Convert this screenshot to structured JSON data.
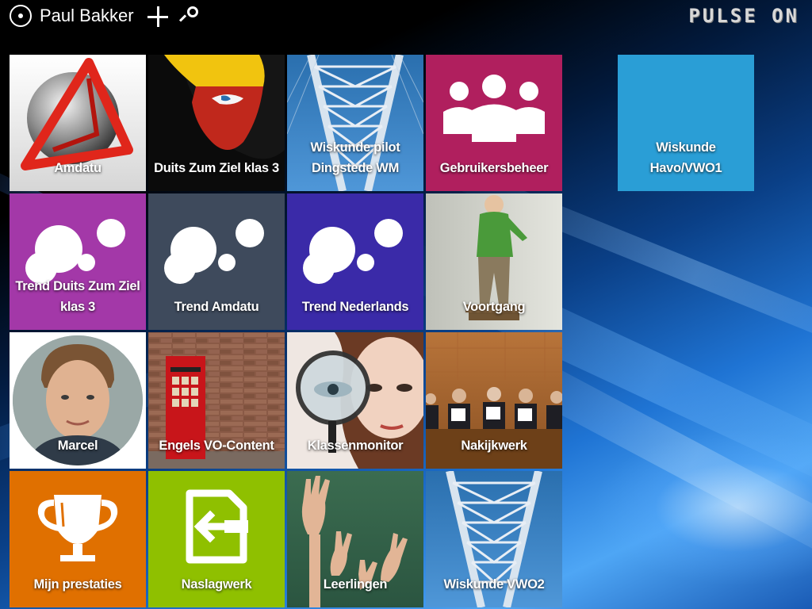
{
  "header": {
    "user_name": "Paul Bakker",
    "logo_text": "PULSE ON",
    "icons": [
      "user-icon",
      "add-icon",
      "search-icon"
    ]
  },
  "tiles": [
    {
      "label": "Amdatu",
      "kind": "logo"
    },
    {
      "label": "Duits Zum Ziel klas 3",
      "kind": "photo"
    },
    {
      "label": "Wiskunde pilot\nDingstede WM",
      "kind": "photo"
    },
    {
      "label": "Gebruikersbeheer",
      "kind": "icon",
      "color": "#b01f5e"
    },
    {
      "label": "Wiskunde\nHavo/VWO1",
      "kind": "plain",
      "color": "#2a9ed6"
    },
    {
      "label": "Trend Duits Zum Ziel\nklas 3",
      "kind": "trend",
      "color": "#a338a8"
    },
    {
      "label": "Trend Amdatu",
      "kind": "trend",
      "color": "#3e4a5c"
    },
    {
      "label": "Trend Nederlands",
      "kind": "trend",
      "color": "#3a2aa8"
    },
    {
      "label": "Voortgang",
      "kind": "photo"
    },
    {
      "label": "Marcel",
      "kind": "photo"
    },
    {
      "label": "Engels VO-Content",
      "kind": "photo"
    },
    {
      "label": "Klassenmonitor",
      "kind": "photo"
    },
    {
      "label": "Nakijkwerk",
      "kind": "photo"
    },
    {
      "label": "Mijn prestaties",
      "kind": "icon",
      "color": "#e07000"
    },
    {
      "label": "Naslagwerk",
      "kind": "icon",
      "color": "#8fc000"
    },
    {
      "label": "Leerlingen",
      "kind": "photo"
    },
    {
      "label": "Wiskunde VWO2",
      "kind": "photo"
    }
  ],
  "colors": {
    "gebruikers": "#b01f5e",
    "wiskunde_havo": "#2a9ed6",
    "trend_duits": "#a338a8",
    "trend_amdatu": "#3e4a5c",
    "trend_nederlands": "#3a2aa8",
    "prestaties": "#e07000",
    "naslagwerk": "#8fc000"
  }
}
